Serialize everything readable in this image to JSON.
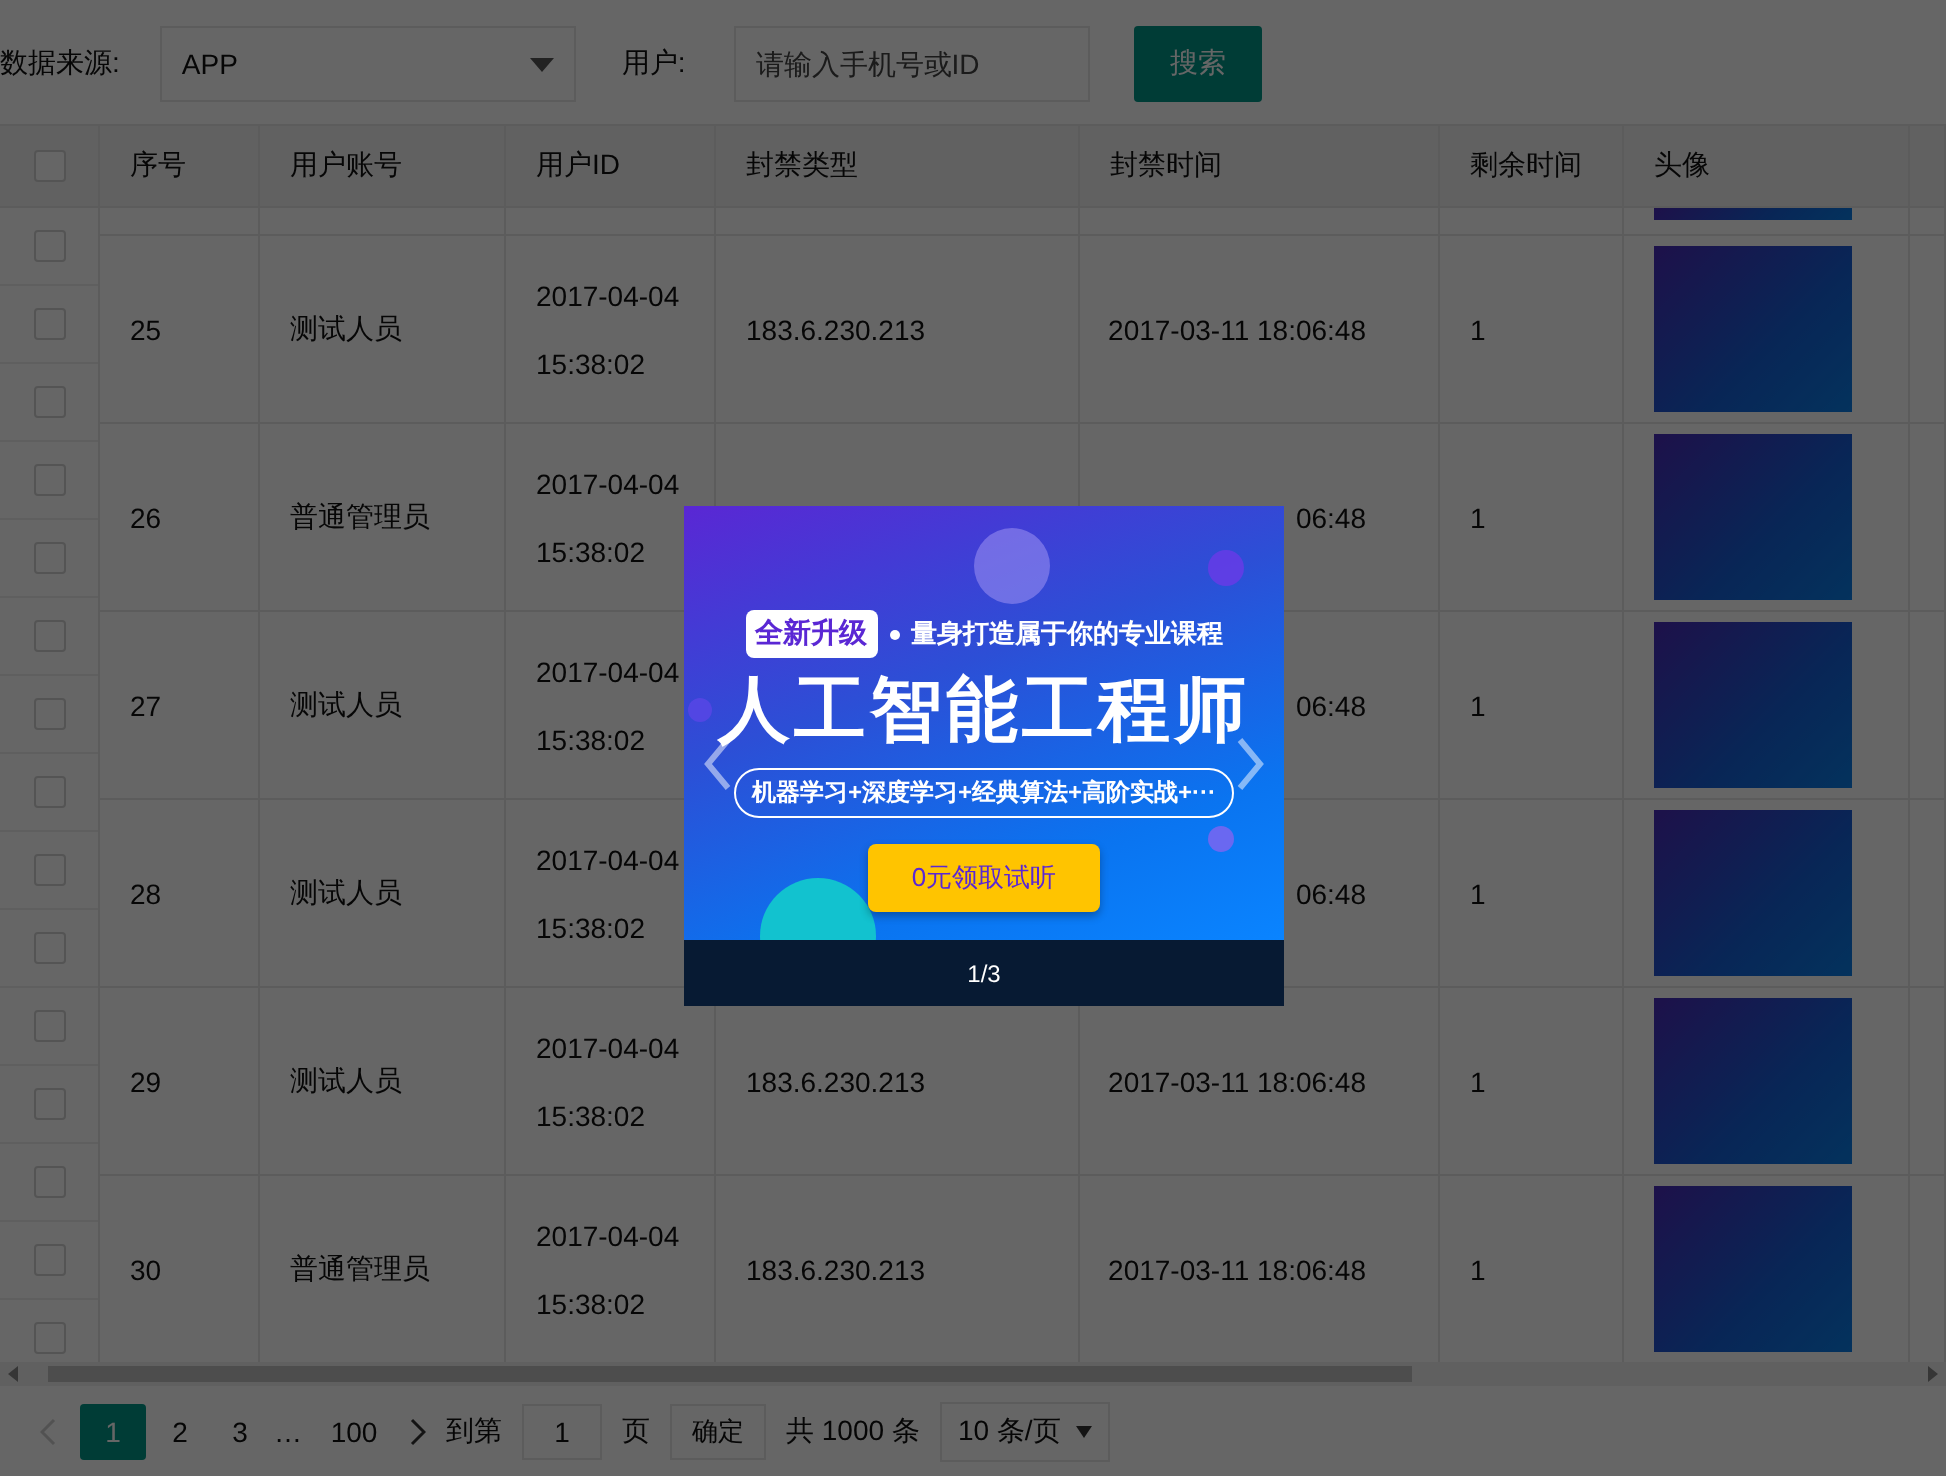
{
  "filters": {
    "source_label": "数据来源:",
    "source_value": "APP",
    "user_label": "用户:",
    "user_placeholder": "请输入手机号或ID",
    "search_button": "搜索"
  },
  "table": {
    "header_checkbox": {
      "checked": false
    },
    "columns": [
      "序号",
      "用户账号",
      "用户ID",
      "封禁类型",
      "封禁时间",
      "剩余时间",
      "头像"
    ],
    "checkboxes": [
      {
        "checked": false
      },
      {
        "checked": false
      },
      {
        "checked": false
      },
      {
        "checked": false
      },
      {
        "checked": false
      },
      {
        "checked": false
      },
      {
        "checked": false
      },
      {
        "checked": false
      },
      {
        "checked": false
      },
      {
        "checked": false
      },
      {
        "checked": false
      },
      {
        "checked": false
      },
      {
        "checked": false
      },
      {
        "checked": false
      },
      {
        "checked": false
      }
    ],
    "rows": [
      {
        "index": "25",
        "account": "测试人员",
        "user_id": "2017-04-04 15:38:02",
        "ban_type": "183.6.230.213",
        "ban_time": "2017-03-11 18:06:48",
        "remaining": "1"
      },
      {
        "index": "26",
        "account": "普通管理员",
        "user_id": "2017-04-04 15:38:02",
        "ban_time": "06:48",
        "remaining": "1"
      },
      {
        "index": "27",
        "account": "测试人员",
        "user_id": "2017-04-04 15:38:02",
        "ban_time": "06:48",
        "remaining": "1"
      },
      {
        "index": "28",
        "account": "测试人员",
        "user_id": "2017-04-04 15:38:02",
        "ban_time": "06:48",
        "remaining": "1"
      },
      {
        "index": "29",
        "account": "测试人员",
        "user_id": "2017-04-04 15:38:02",
        "ban_type": "183.6.230.213",
        "ban_time": "2017-03-11 18:06:48",
        "remaining": "1"
      },
      {
        "index": "30",
        "account": "普通管理员",
        "user_id": "2017-04-04 15:38:02",
        "ban_type": "183.6.230.213",
        "ban_time": "2017-03-11 18:06:48",
        "remaining": "1"
      }
    ]
  },
  "pagination": {
    "pages": [
      {
        "kind": "page",
        "label": "1",
        "selected": true
      },
      {
        "kind": "page",
        "label": "2",
        "selected": false
      },
      {
        "kind": "page",
        "label": "3",
        "selected": false
      },
      {
        "kind": "ellipsis",
        "label": "…"
      },
      {
        "kind": "page",
        "label": "100",
        "selected": false
      }
    ],
    "goto_label": "到第",
    "goto_value": "1",
    "page_unit": "页",
    "confirm": "确定",
    "total": "共 1000 条",
    "page_size": "10 条/页"
  },
  "modal": {
    "banner": {
      "badge": "全新升级",
      "tagline": "量身打造属于你的专业课程",
      "title": "人工智能工程师",
      "topics": "机器学习+深度学习+经典算法+高阶实战+···",
      "cta": "0元领取试听"
    },
    "counter": "1/3"
  }
}
